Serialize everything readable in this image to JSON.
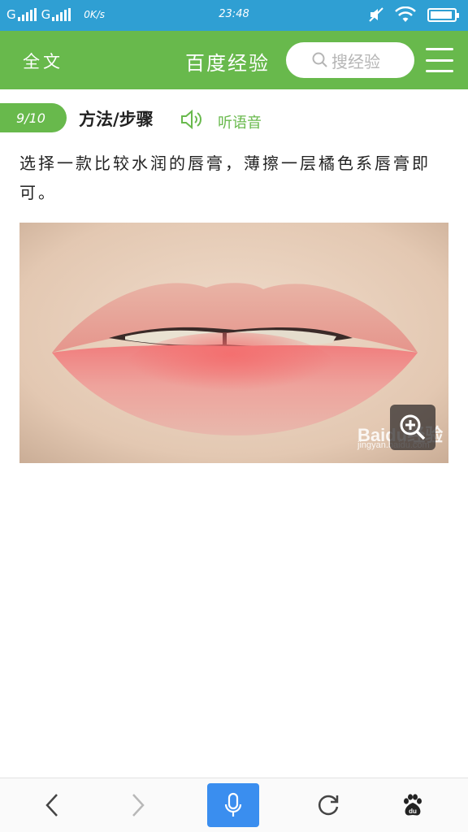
{
  "status_bar": {
    "signal1_label": "G",
    "signal2_label": "G",
    "speed": "0K/s",
    "time": "23:48"
  },
  "header": {
    "full_text_label": "全文",
    "site_title": "百度经验",
    "search_placeholder": "搜经验"
  },
  "step": {
    "counter": "9/10",
    "title": "方法/步骤",
    "listen_label": "听语音",
    "text": "选择一款比较水润的唇膏，薄擦一层橘色系唇膏即可。"
  },
  "image": {
    "watermark": "Baidu经验",
    "watermark_url": "jingyan.baidu.com"
  },
  "colors": {
    "status_bar": "#2f9fd3",
    "header_green": "#68b94c",
    "voice_button": "#3a8eef"
  },
  "icons": {
    "back": "chevron-left-icon",
    "forward": "chevron-right-icon",
    "voice": "microphone-icon",
    "refresh": "refresh-icon",
    "home": "baidu-paw-icon",
    "zoom": "zoom-in-icon"
  }
}
